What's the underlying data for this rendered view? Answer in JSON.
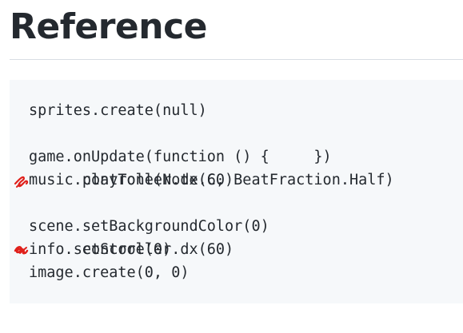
{
  "page": {
    "title": "Reference"
  },
  "code": {
    "lines": [
      {
        "text": "sprites.create(null)",
        "marker": false
      },
      {
        "text": "controller.dx(60)",
        "marker": true
      },
      {
        "text": "game.onUpdate(function () {     })",
        "marker": false
      },
      {
        "text": "music.playTone(Note.C, BeatFraction.Half)",
        "marker": false
      },
      {
        "text": "controller.dx(60)",
        "marker": true
      },
      {
        "text": "scene.setBackgroundColor(0)",
        "marker": false
      },
      {
        "text": "info.setScore(0)",
        "marker": false
      },
      {
        "text": "image.create(0, 0)",
        "marker": false
      }
    ],
    "marker_color": "#e0201b",
    "marker_icon": "red-scribble-annotation-icon"
  },
  "colors": {
    "background": "#ffffff",
    "code_background": "#f6f8fa",
    "rule": "#d8dee4",
    "text": "#24292f"
  }
}
